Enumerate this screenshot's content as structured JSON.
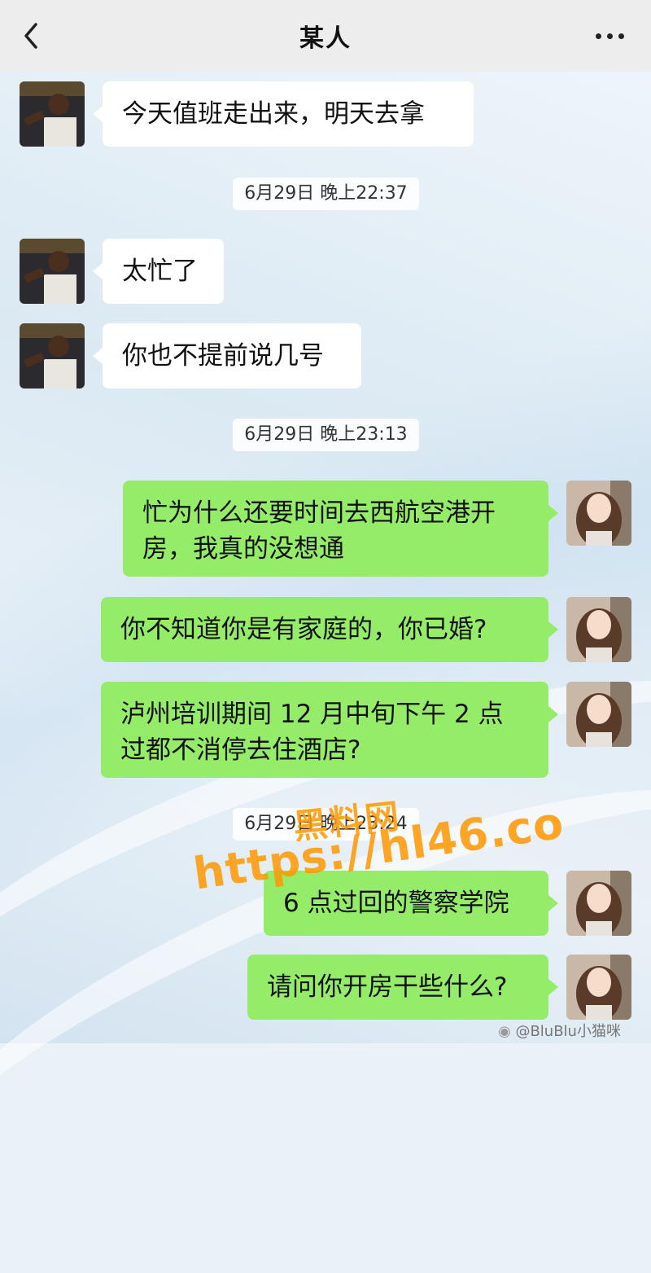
{
  "header": {
    "title": "某人"
  },
  "messages": [
    {
      "text": "今天值班走出来，明天去拿"
    },
    {
      "time": "6月29日 晚上22:37"
    },
    {
      "text": "太忙了"
    },
    {
      "text": "你也不提前说几号"
    },
    {
      "time": "6月29日 晚上23:13"
    },
    {
      "line1": "忙为什么还要时间去西航空港开",
      "line2": "房，我真的没想通"
    },
    {
      "text": "你不知道你是有家庭的，你已婚?"
    },
    {
      "line1": "泸州培训期间 12 月中旬下午 2 点",
      "line2": "过都不消停去住酒店?"
    },
    {
      "time": "6月29日 晚上23:24"
    },
    {
      "text": "6 点过回的警察学院"
    },
    {
      "text": "请问你开房干些什么?"
    }
  ],
  "watermark": {
    "site": "黑料网",
    "url": "https://hl46.co"
  },
  "credit": "@BluBlu小猫咪",
  "colors": {
    "incoming": "#ffffff",
    "outgoing": "#95ec69",
    "header": "#ededed"
  }
}
